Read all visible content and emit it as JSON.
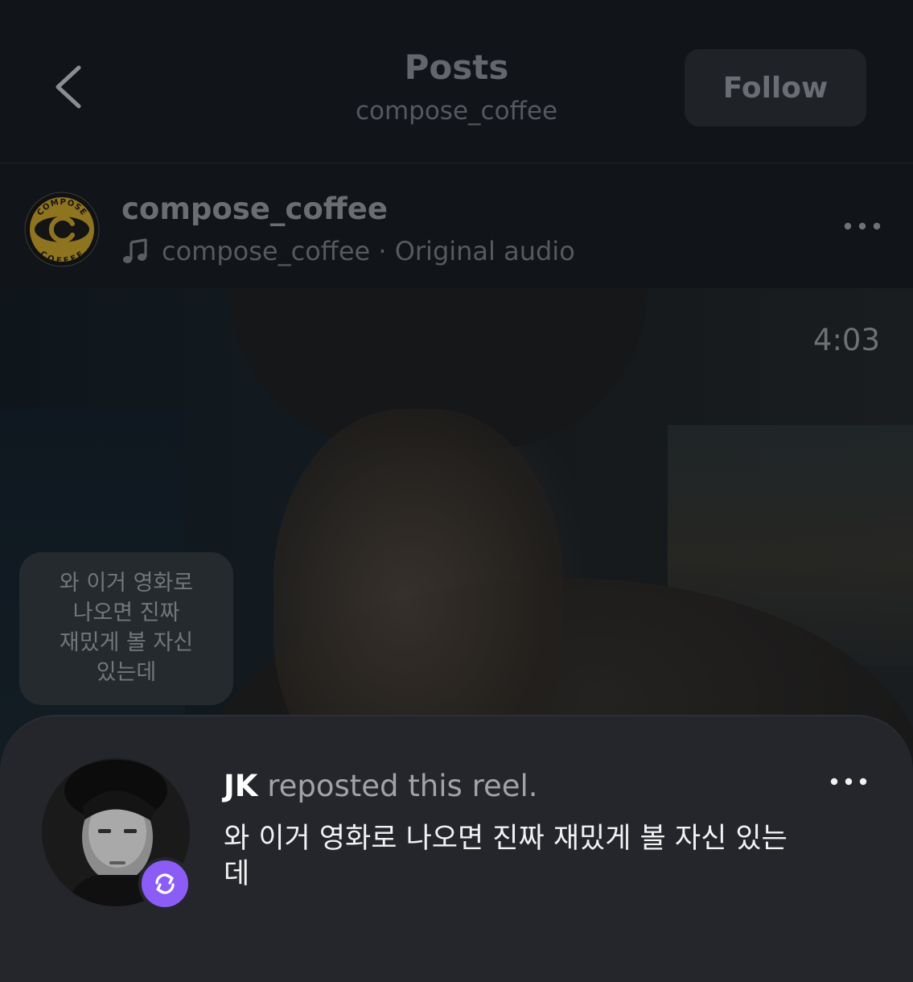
{
  "header": {
    "title": "Posts",
    "subtitle": "compose_coffee",
    "follow_label": "Follow"
  },
  "post": {
    "username": "compose_coffee",
    "audio": "compose_coffee · Original audio",
    "logo_top_text": "COMPOSE",
    "logo_bottom_text": "COFFEE",
    "logo_color": "#c9a227"
  },
  "video": {
    "timestamp": "4:03",
    "caption": "와 이거 영화로 나오면 진짜 재밌게 볼 자신 있는데"
  },
  "repost": {
    "name": "JK",
    "action": "reposted this reel.",
    "comment": "와 이거 영화로 나오면 진짜 재밌게 볼 자신 있는데",
    "badge_color": "#8b5cf6"
  },
  "icons": {
    "back": "chevron-left-icon",
    "music": "music-note-icon",
    "more": "more-horizontal-icon",
    "repost": "repost-icon"
  }
}
